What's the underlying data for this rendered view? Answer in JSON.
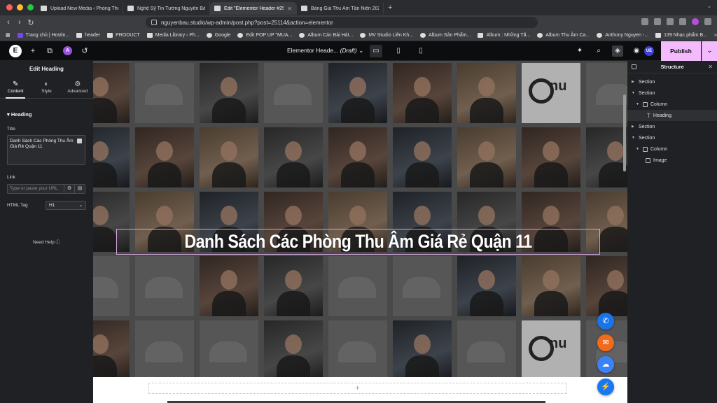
{
  "browser": {
    "traffic_colors": [
      "#ff5f57",
      "#febc2e",
      "#28c840"
    ],
    "tabs": [
      {
        "title": "Upload New Media ‹ Phòng Thu Â",
        "active": false
      },
      {
        "title": "Nghệ Sỹ Tin Tưởng Nguyễn Báu St",
        "active": false
      },
      {
        "title": "Edit \"Elementor Header #2511",
        "active": true
      },
      {
        "title": "Bảng Giá Thu Âm Tân Niên 2026 P",
        "active": false
      }
    ],
    "new_tab": "+",
    "url": "nguyenbau.studio/wp-admin/post.php?post=25114&action=elementor",
    "bookmarks": [
      "Trang chủ | Hostin...",
      "header",
      "PRODUCT",
      "Media Library ‹ Ph...",
      "Google",
      "Edit POP UP \"MUA...",
      "Album Các Bài Hát...",
      "MV Studio Liên Kh...",
      "Album Sản Phẩm...",
      "Album : Những Tã...",
      "Album Thu Âm Ca...",
      "Anthony Nguyen -...",
      "139 Nhạc phẩm B..."
    ],
    "bookmarks_more": "»"
  },
  "topbar": {
    "logo": "E",
    "avatar_letter": "A",
    "doc_title": "Elementor Heade...",
    "doc_status": "(Draft)",
    "user_initials": "UE",
    "publish_label": "Publish",
    "accent": "#f3bafd"
  },
  "left_panel": {
    "title": "Edit Heading",
    "tabs": [
      {
        "label": "Content",
        "icon": "pencil-icon",
        "active": true
      },
      {
        "label": "Style",
        "icon": "half-circle-icon",
        "active": false
      },
      {
        "label": "Advanced",
        "icon": "gear-icon",
        "active": false
      }
    ],
    "section_heading": "Heading",
    "title_label": "Title",
    "title_value": "Danh Sách Các Phòng Thu Âm Giá Rẻ Quận 11",
    "link_label": "Link",
    "link_placeholder": "Type or paste your URL",
    "html_tag_label": "HTML Tag",
    "html_tag_value": "H1",
    "need_help": "Need Help"
  },
  "canvas": {
    "heading": "Danh Sách Các Phòng Thu Âm Giá Rẻ Quận 11",
    "add_section": "+",
    "float_buttons": [
      {
        "icon": "phone-icon",
        "color": "#1a73e8"
      },
      {
        "icon": "mail-icon",
        "color": "#f26b1d"
      },
      {
        "icon": "chat-icon",
        "color": "#3b82f6"
      },
      {
        "icon": "messenger-icon",
        "color": "#1877f2"
      }
    ]
  },
  "structure": {
    "title": "Structure",
    "items": [
      {
        "label": "Section",
        "depth": 0,
        "selected": false
      },
      {
        "label": "Section",
        "depth": 0,
        "selected": false
      },
      {
        "label": "Column",
        "depth": 1,
        "selected": false
      },
      {
        "label": "Heading",
        "depth": 2,
        "selected": true
      },
      {
        "label": "Section",
        "depth": 0,
        "selected": false
      },
      {
        "label": "Section",
        "depth": 0,
        "selected": false
      },
      {
        "label": "Column",
        "depth": 1,
        "selected": false
      },
      {
        "label": "Image",
        "depth": 2,
        "selected": false
      }
    ]
  }
}
